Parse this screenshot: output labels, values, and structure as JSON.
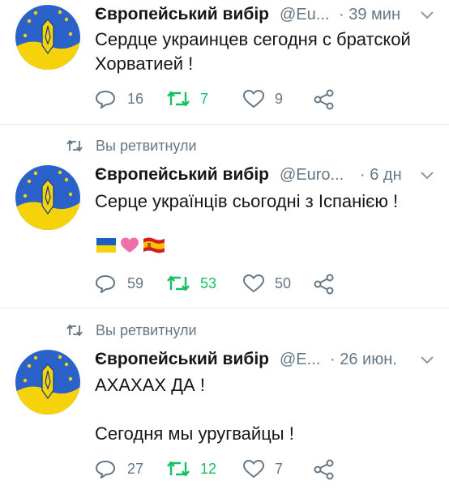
{
  "colors": {
    "text": "#14171a",
    "secondary": "#657786",
    "retweet_active": "#17bf63",
    "divider": "#e6ecf0",
    "flag_blue": "#1d5fc1",
    "flag_yellow": "#f5d20a"
  },
  "tweets": [
    {
      "retweeted_label": "",
      "author_name": "Європейський вибір",
      "handle": "@Eu...",
      "time": "· 39 мин",
      "text_lines": [
        "Сердце украинцев сегодня с братской",
        "Хорватией !"
      ],
      "emoji": [],
      "replies": "16",
      "retweets": "7",
      "likes": "9",
      "icons": [
        "avatar-icon",
        "chevron-down-icon",
        "reply-icon",
        "retweet-icon",
        "like-icon",
        "share-icon"
      ]
    },
    {
      "retweeted_label": "Вы ретвитнули",
      "author_name": "Європейський вибір",
      "handle": "@Euro...",
      "time": "· 6 дн",
      "text_lines": [
        "Серце українців сьогодні з Іспанією !"
      ],
      "emoji": [
        "ukraine-flag-emoji",
        "pink-heart-emoji",
        "spain-flag-emoji"
      ],
      "replies": "59",
      "retweets": "53",
      "likes": "50"
    },
    {
      "retweeted_label": "Вы ретвитнули",
      "author_name": "Європейський вибір",
      "handle": "@E...",
      "time": "· 26 июн.",
      "text_lines": [
        "АХАХАХ ДА !",
        "",
        "Сегодня мы уругвайцы !"
      ],
      "emoji": [],
      "replies": "27",
      "retweets": "12",
      "likes": "7"
    }
  ]
}
